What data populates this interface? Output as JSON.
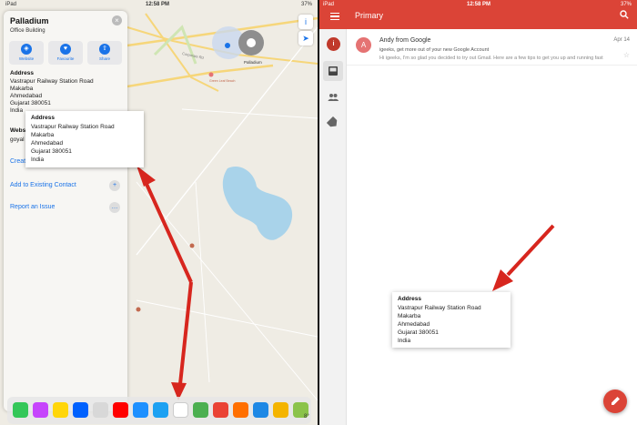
{
  "left_status": {
    "carrier": "iPad",
    "time": "12:58 PM",
    "battery": "37%"
  },
  "place": {
    "name": "Palladium",
    "category": "Office Building",
    "actions": [
      {
        "label": "Website",
        "icon": "compass-icon"
      },
      {
        "label": "Favourite",
        "icon": "heart-icon"
      },
      {
        "label": "Share",
        "icon": "share-icon"
      }
    ],
    "address_heading": "Address",
    "address_lines": [
      "Vastrapur Railway Station Road",
      "Makarba",
      "Ahmedabad",
      "Gujarat 380051",
      "India"
    ],
    "website_heading": "Website",
    "website_value": "goyal",
    "create_label": "Creat",
    "add_existing_label": "Add to Existing Contact",
    "report_label": "Report an Issue"
  },
  "map": {
    "labels": {
      "corporate_rd": "Corporate Rd",
      "palladium_pin": "Palladium",
      "green_leaf": "Green Leaf Beach"
    },
    "marker_glyphs": {
      "info": "i",
      "locate": "➤"
    }
  },
  "popup_left": {
    "heading": "Address",
    "lines": [
      "Vastrapur Railway Station Road",
      "Makarba",
      "Ahmedabad",
      "Gujarat 380051",
      "India"
    ]
  },
  "dock_right_text": "8°",
  "right_status": {
    "carrier": "iPad",
    "time": "12:58 PM",
    "battery": "37%"
  },
  "gmail": {
    "folder": "Primary",
    "account_initial": "i",
    "email": {
      "avatar_initial": "A",
      "sender": "Andy from Google",
      "subject": "igeeks, get more out of your new Google Account",
      "snippet": "Hi igeeks, I'm so glad you decided to try out Gmail. Here are a few tips to get you up and running fast",
      "date": "Apr 14"
    }
  },
  "popup_right": {
    "heading": "Address",
    "lines": [
      "Vastrapur Railway Station Road",
      "Makarba",
      "Ahmedabad",
      "Gujarat 380051",
      "India"
    ]
  },
  "colors": {
    "gmail_red": "#db4437",
    "ios_blue": "#1a73e8",
    "arrow_red": "#d7261e",
    "map_bg": "#efece4",
    "water": "#a9d3ea"
  }
}
